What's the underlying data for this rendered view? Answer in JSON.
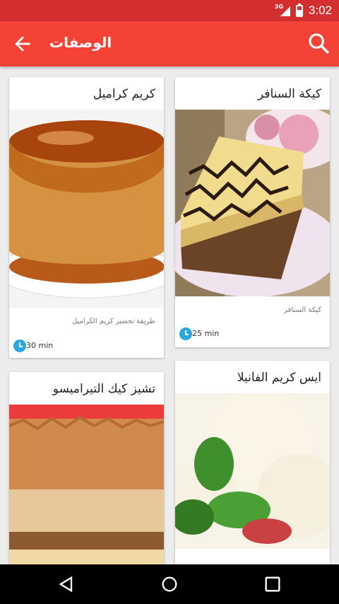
{
  "status_bar": {
    "network": "3G",
    "time": "3:02"
  },
  "app_bar": {
    "title": "الوصفات"
  },
  "recipes": [
    {
      "title": "كيكة السنافر",
      "description": "كيكة السنافر",
      "time": "25 min"
    },
    {
      "title": "كريم كراميل",
      "description": "طريقة تحضير كريم الكراميل",
      "time": "30 min"
    },
    {
      "title": "ايس كريم الفانيلا",
      "description": "",
      "time": ""
    },
    {
      "title": "تشيز كيك التيراميسو",
      "description": "",
      "time": ""
    }
  ],
  "colors": {
    "status_bar": "#d32f2f",
    "app_bar": "#f44336",
    "clock_icon": "#29a8e0"
  }
}
